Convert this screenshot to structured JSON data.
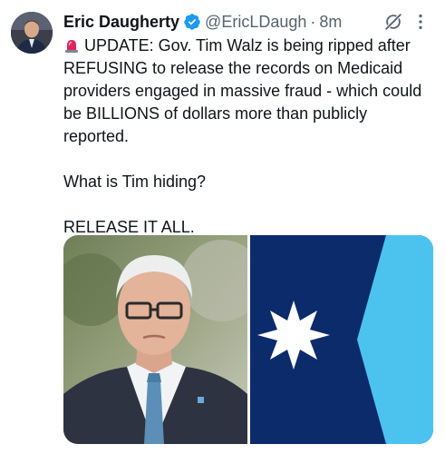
{
  "author": {
    "display_name": "Eric Daugherty",
    "handle": "@EricLDaugh",
    "separator": "·",
    "time": "8m",
    "verified_color": "#1d9bf0"
  },
  "tweet": {
    "line1_emoji": "siren-emoji",
    "paragraph1": "UPDATE: Gov. Tim Walz is being ripped after REFUSING to release the records on Medicaid providers engaged in massive fraud - which could be BILLIONS of dollars more than publicly reported.",
    "paragraph2": "What is Tim hiding?",
    "paragraph3": "RELEASE IT ALL."
  },
  "media": {
    "left_image": "portrait-photo",
    "right_image": "minnesota-flag",
    "flag_colors": {
      "dark_blue": "#0b2b6b",
      "light_blue": "#4cc3ef",
      "star": "#ffffff"
    }
  },
  "icons": {
    "grok": "grok-icon",
    "more": "more-icon"
  }
}
